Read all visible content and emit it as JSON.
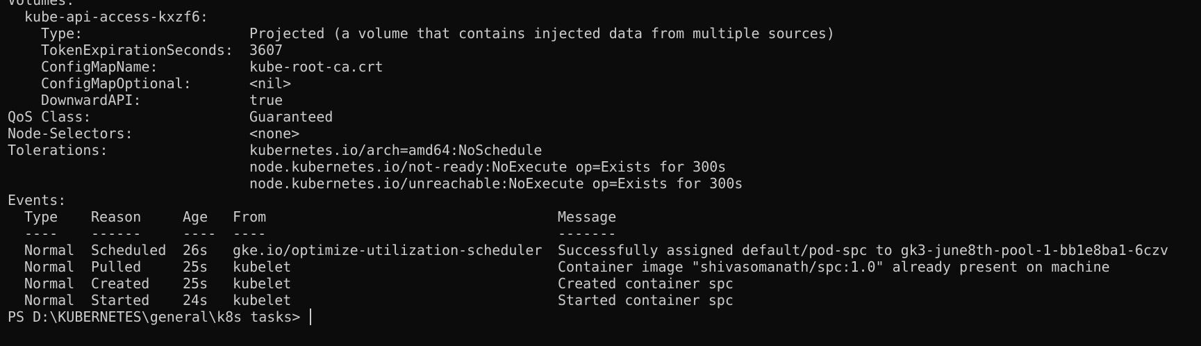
{
  "terminal": {
    "volumes_header": "Volumes:",
    "volume_name": "kube-api-access-kxzf6:",
    "volume_fields": [
      {
        "key": "Type:",
        "value": "Projected (a volume that contains injected data from multiple sources)"
      },
      {
        "key": "TokenExpirationSeconds:",
        "value": "3607"
      },
      {
        "key": "ConfigMapName:",
        "value": "kube-root-ca.crt"
      },
      {
        "key": "ConfigMapOptional:",
        "value": "<nil>"
      },
      {
        "key": "DownwardAPI:",
        "value": "true"
      }
    ],
    "pod_fields": [
      {
        "key": "QoS Class:",
        "value": "Guaranteed"
      },
      {
        "key": "Node-Selectors:",
        "value": "<none>"
      },
      {
        "key": "Tolerations:",
        "value": "kubernetes.io/arch=amd64:NoSchedule"
      }
    ],
    "tolerations_more": [
      "node.kubernetes.io/not-ready:NoExecute op=Exists for 300s",
      "node.kubernetes.io/unreachable:NoExecute op=Exists for 300s"
    ],
    "events_header": "Events:",
    "events_columns": [
      "Type",
      "Reason",
      "Age",
      "From",
      "Message"
    ],
    "events_separators": [
      "----",
      "------",
      "----",
      "----",
      "-------"
    ],
    "events": [
      [
        "Normal",
        "Scheduled",
        "26s",
        "gke.io/optimize-utilization-scheduler",
        "Successfully assigned default/pod-spc to gk3-june8th-pool-1-bb1e8ba1-6czv"
      ],
      [
        "Normal",
        "Pulled",
        "25s",
        "kubelet",
        "Container image \"shivasomanath/spc:1.0\" already present on machine"
      ],
      [
        "Normal",
        "Created",
        "25s",
        "kubelet",
        "Created container spc"
      ],
      [
        "Normal",
        "Started",
        "24s",
        "kubelet",
        "Started container spc"
      ]
    ],
    "prompt": "PS D:\\KUBERNETES\\general\\k8s tasks> "
  }
}
